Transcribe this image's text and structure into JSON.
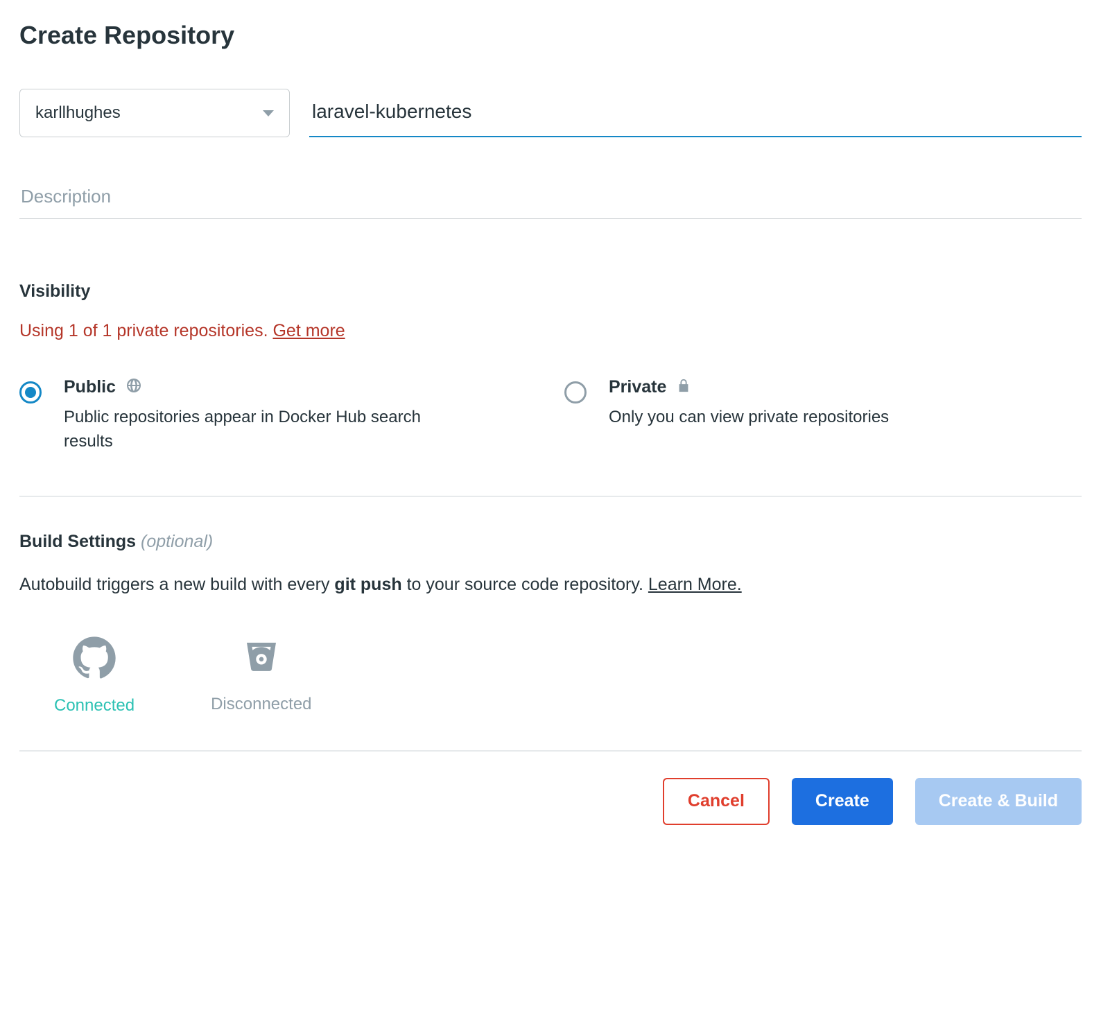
{
  "page_title": "Create Repository",
  "namespace": {
    "selected": "karllhughes"
  },
  "repo_name": {
    "value": "laravel-kubernetes"
  },
  "description": {
    "placeholder": "Description",
    "value": ""
  },
  "visibility": {
    "label": "Visibility",
    "quota_text": "Using 1 of 1 private repositories. ",
    "quota_link": "Get more",
    "public": {
      "title": "Public",
      "desc": "Public repositories appear in Docker Hub search results",
      "selected": true
    },
    "private": {
      "title": "Private",
      "desc": "Only you can view private repositories",
      "selected": false
    }
  },
  "build": {
    "heading": "Build Settings",
    "optional": "(optional)",
    "text_pre": "Autobuild triggers a new build with every ",
    "text_bold": "git push",
    "text_post": " to your source code repository. ",
    "learn_more": "Learn More.",
    "github_status": "Connected",
    "bitbucket_status": "Disconnected"
  },
  "buttons": {
    "cancel": "Cancel",
    "create": "Create",
    "create_build": "Create & Build"
  }
}
